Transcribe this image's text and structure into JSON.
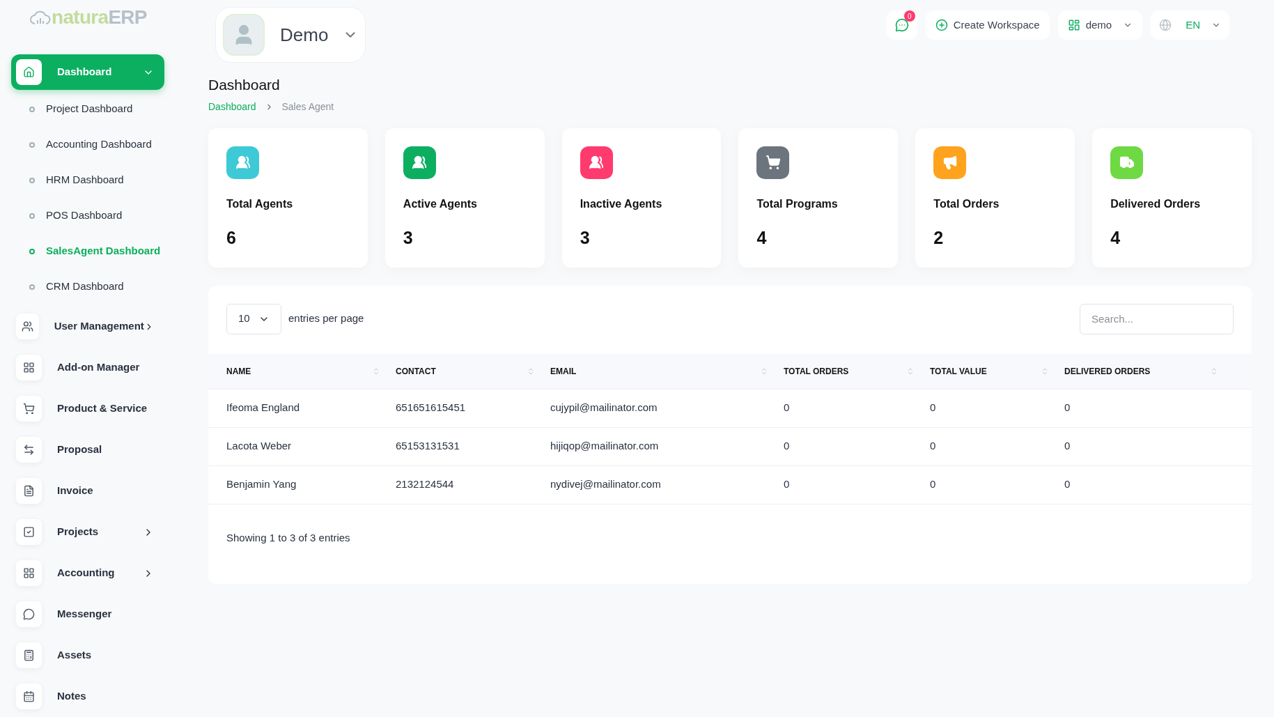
{
  "logo": {
    "part1": "natura",
    "part2": "ERP"
  },
  "user_switcher": {
    "name": "Demo"
  },
  "topbar": {
    "notifications": "0",
    "create": "Create Workspace",
    "workspace": "demo",
    "language": "EN"
  },
  "sidebar": {
    "items": [
      {
        "label": "Dashboard",
        "selected": true,
        "expanded": true,
        "children": [
          {
            "label": "Project Dashboard",
            "selected": false
          },
          {
            "label": "Accounting Dashboard",
            "selected": false
          },
          {
            "label": "HRM Dashboard",
            "selected": false
          },
          {
            "label": "POS Dashboard",
            "selected": false
          },
          {
            "label": "SalesAgent Dashboard",
            "selected": true
          },
          {
            "label": "CRM Dashboard",
            "selected": false
          }
        ]
      },
      {
        "label": "User Management",
        "selected": false,
        "expanded": false
      },
      {
        "label": "Add-on Manager",
        "selected": false
      },
      {
        "label": "Product & Service",
        "selected": false
      },
      {
        "label": "Proposal",
        "selected": false
      },
      {
        "label": "Invoice",
        "selected": false
      },
      {
        "label": "Projects",
        "selected": false,
        "expanded": false
      },
      {
        "label": "Accounting",
        "selected": false,
        "expanded": false
      },
      {
        "label": "Messenger",
        "selected": false
      },
      {
        "label": "Assets",
        "selected": false
      },
      {
        "label": "Notes",
        "selected": false
      }
    ]
  },
  "page": {
    "title": "Dashboard",
    "breadcrumb": [
      "Dashboard",
      "Sales Agent"
    ]
  },
  "stats": [
    {
      "label": "Total Agents",
      "value": "6",
      "color": "#3ec9d6"
    },
    {
      "label": "Active Agents",
      "value": "3",
      "color": "#0caf60"
    },
    {
      "label": "Inactive Agents",
      "value": "3",
      "color": "#ff3a6e"
    },
    {
      "label": "Total Programs",
      "value": "4",
      "color": "#6c757d"
    },
    {
      "label": "Total Orders",
      "value": "2",
      "color": "#ffa21d"
    },
    {
      "label": "Delivered Orders",
      "value": "4",
      "color": "#6fd943"
    }
  ],
  "table": {
    "page_size": "10",
    "page_size_label": "entries per page",
    "search_placeholder": "Search...",
    "columns": [
      "NAME",
      "CONTACT",
      "EMAIL",
      "TOTAL ORDERS",
      "TOTAL VALUE",
      "DELIVERED ORDERS"
    ],
    "rows": [
      [
        "Ifeoma England",
        "651651615451",
        "cujypil@mailinator.com",
        "0",
        "0",
        "0"
      ],
      [
        "Lacota Weber",
        "65153131531",
        "hijiqop@mailinator.com",
        "0",
        "0",
        "0"
      ],
      [
        "Benjamin Yang",
        "2132124544",
        "nydivej@mailinator.com",
        "0",
        "0",
        "0"
      ]
    ],
    "footer": "Showing 1 to 3 of 3 entries"
  }
}
